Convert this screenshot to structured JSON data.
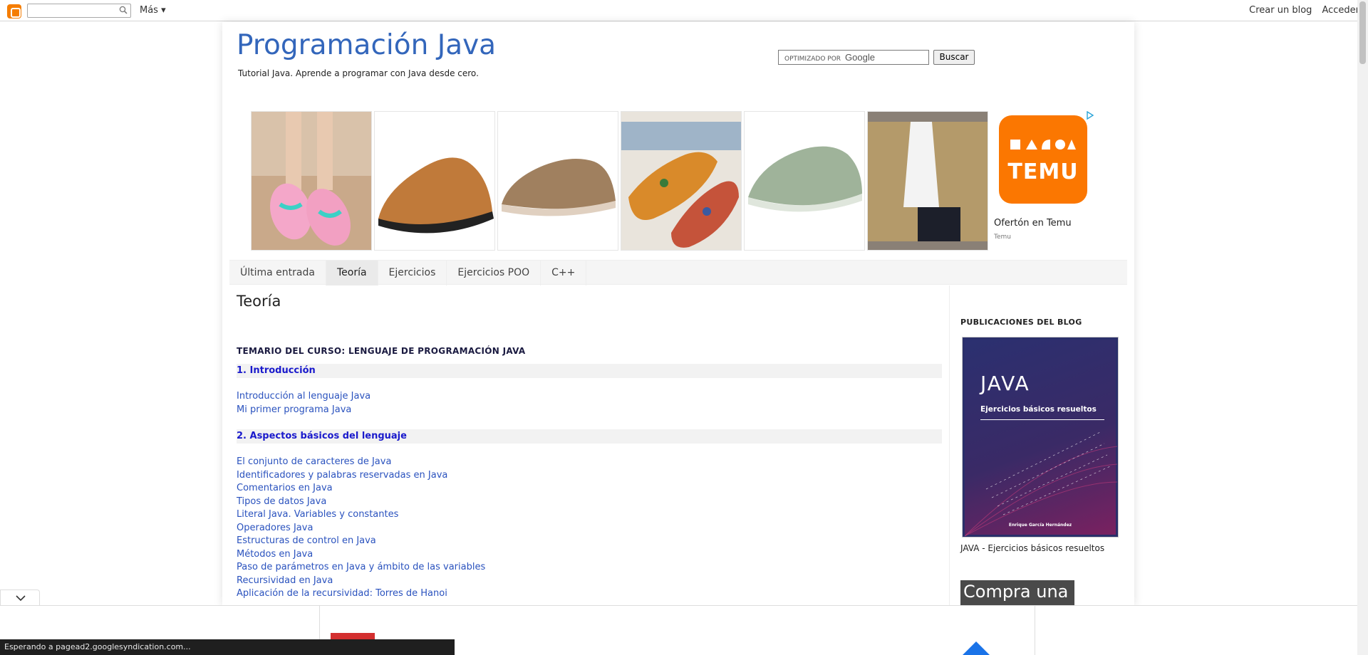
{
  "navbar": {
    "search_placeholder": "",
    "more_label": "Más ▾",
    "create_blog": "Crear un blog",
    "sign_in": "Acceder"
  },
  "header": {
    "title": "Programación Java",
    "description": "Tutorial Java. Aprende a programar con Java desde cero."
  },
  "google_search": {
    "powered_label": "OPTIMIZADO POR",
    "google_label": "Google",
    "button_label": "Buscar"
  },
  "ad": {
    "caption": "Ofertón en Temu",
    "advertiser": "Temu",
    "brand_word": "TEMU",
    "brand_color": "#fb7701",
    "tiles": [
      "shoe-image",
      "shoe-image",
      "shoe-image",
      "shoe-image",
      "shoe-image",
      "jacket-image"
    ]
  },
  "tabs": [
    {
      "label": "Última entrada",
      "active": false
    },
    {
      "label": "Teoría",
      "active": true
    },
    {
      "label": "Ejercicios",
      "active": false
    },
    {
      "label": "Ejercicios POO",
      "active": false
    },
    {
      "label": "C++",
      "active": false
    }
  ],
  "main": {
    "page_title": "Teoría",
    "course_heading": "TEMARIO DEL CURSO: LENGUAJE DE PROGRAMACIÓN JAVA",
    "sections": [
      {
        "heading": "1. Introducción",
        "links": [
          "Introducción al lenguaje Java",
          "Mi primer programa Java"
        ]
      },
      {
        "heading": "2. Aspectos básicos del lenguaje",
        "links": [
          "El conjunto de caracteres de Java",
          "Identificadores y palabras reservadas en Java",
          "Comentarios en Java",
          "Tipos de datos Java",
          "Literal Java. Variables y constantes",
          "Operadores Java",
          "Estructuras de control en Java",
          "Métodos en Java",
          "Paso de parámetros en Java y ámbito de las variables",
          "Recursividad en Java",
          "Aplicación de la recursividad: Torres de Hanoi"
        ]
      }
    ]
  },
  "sidebar": {
    "heading": "PUBLICACIONES DEL BLOG",
    "book": {
      "title": "JAVA",
      "subtitle": "Ejercicios básicos resueltos",
      "author": "Enrique García Hernández"
    },
    "book_caption": "JAVA - Ejercicios básicos resueltos",
    "ad_text": "Compra una"
  },
  "status_bar": {
    "text": "Esperando a pagead2.googlesyndication.com..."
  },
  "colors": {
    "title_blue": "#3366bb",
    "link_blue": "#2a52be",
    "section_blue": "#1a1acc",
    "blogger_orange": "#f57d00"
  }
}
